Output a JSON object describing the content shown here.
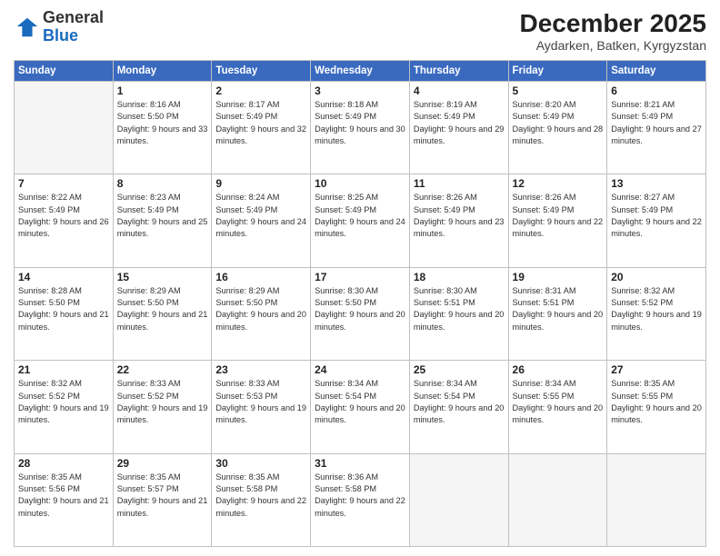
{
  "logo": {
    "general": "General",
    "blue": "Blue"
  },
  "title": {
    "month": "December 2025",
    "location": "Aydarken, Batken, Kyrgyzstan"
  },
  "headers": [
    "Sunday",
    "Monday",
    "Tuesday",
    "Wednesday",
    "Thursday",
    "Friday",
    "Saturday"
  ],
  "weeks": [
    [
      {
        "day": "",
        "empty": true
      },
      {
        "day": "1",
        "sunrise": "Sunrise: 8:16 AM",
        "sunset": "Sunset: 5:50 PM",
        "daylight": "Daylight: 9 hours and 33 minutes."
      },
      {
        "day": "2",
        "sunrise": "Sunrise: 8:17 AM",
        "sunset": "Sunset: 5:49 PM",
        "daylight": "Daylight: 9 hours and 32 minutes."
      },
      {
        "day": "3",
        "sunrise": "Sunrise: 8:18 AM",
        "sunset": "Sunset: 5:49 PM",
        "daylight": "Daylight: 9 hours and 30 minutes."
      },
      {
        "day": "4",
        "sunrise": "Sunrise: 8:19 AM",
        "sunset": "Sunset: 5:49 PM",
        "daylight": "Daylight: 9 hours and 29 minutes."
      },
      {
        "day": "5",
        "sunrise": "Sunrise: 8:20 AM",
        "sunset": "Sunset: 5:49 PM",
        "daylight": "Daylight: 9 hours and 28 minutes."
      },
      {
        "day": "6",
        "sunrise": "Sunrise: 8:21 AM",
        "sunset": "Sunset: 5:49 PM",
        "daylight": "Daylight: 9 hours and 27 minutes."
      }
    ],
    [
      {
        "day": "7",
        "sunrise": "Sunrise: 8:22 AM",
        "sunset": "Sunset: 5:49 PM",
        "daylight": "Daylight: 9 hours and 26 minutes."
      },
      {
        "day": "8",
        "sunrise": "Sunrise: 8:23 AM",
        "sunset": "Sunset: 5:49 PM",
        "daylight": "Daylight: 9 hours and 25 minutes."
      },
      {
        "day": "9",
        "sunrise": "Sunrise: 8:24 AM",
        "sunset": "Sunset: 5:49 PM",
        "daylight": "Daylight: 9 hours and 24 minutes."
      },
      {
        "day": "10",
        "sunrise": "Sunrise: 8:25 AM",
        "sunset": "Sunset: 5:49 PM",
        "daylight": "Daylight: 9 hours and 24 minutes."
      },
      {
        "day": "11",
        "sunrise": "Sunrise: 8:26 AM",
        "sunset": "Sunset: 5:49 PM",
        "daylight": "Daylight: 9 hours and 23 minutes."
      },
      {
        "day": "12",
        "sunrise": "Sunrise: 8:26 AM",
        "sunset": "Sunset: 5:49 PM",
        "daylight": "Daylight: 9 hours and 22 minutes."
      },
      {
        "day": "13",
        "sunrise": "Sunrise: 8:27 AM",
        "sunset": "Sunset: 5:49 PM",
        "daylight": "Daylight: 9 hours and 22 minutes."
      }
    ],
    [
      {
        "day": "14",
        "sunrise": "Sunrise: 8:28 AM",
        "sunset": "Sunset: 5:50 PM",
        "daylight": "Daylight: 9 hours and 21 minutes."
      },
      {
        "day": "15",
        "sunrise": "Sunrise: 8:29 AM",
        "sunset": "Sunset: 5:50 PM",
        "daylight": "Daylight: 9 hours and 21 minutes."
      },
      {
        "day": "16",
        "sunrise": "Sunrise: 8:29 AM",
        "sunset": "Sunset: 5:50 PM",
        "daylight": "Daylight: 9 hours and 20 minutes."
      },
      {
        "day": "17",
        "sunrise": "Sunrise: 8:30 AM",
        "sunset": "Sunset: 5:50 PM",
        "daylight": "Daylight: 9 hours and 20 minutes."
      },
      {
        "day": "18",
        "sunrise": "Sunrise: 8:30 AM",
        "sunset": "Sunset: 5:51 PM",
        "daylight": "Daylight: 9 hours and 20 minutes."
      },
      {
        "day": "19",
        "sunrise": "Sunrise: 8:31 AM",
        "sunset": "Sunset: 5:51 PM",
        "daylight": "Daylight: 9 hours and 20 minutes."
      },
      {
        "day": "20",
        "sunrise": "Sunrise: 8:32 AM",
        "sunset": "Sunset: 5:52 PM",
        "daylight": "Daylight: 9 hours and 19 minutes."
      }
    ],
    [
      {
        "day": "21",
        "sunrise": "Sunrise: 8:32 AM",
        "sunset": "Sunset: 5:52 PM",
        "daylight": "Daylight: 9 hours and 19 minutes."
      },
      {
        "day": "22",
        "sunrise": "Sunrise: 8:33 AM",
        "sunset": "Sunset: 5:52 PM",
        "daylight": "Daylight: 9 hours and 19 minutes."
      },
      {
        "day": "23",
        "sunrise": "Sunrise: 8:33 AM",
        "sunset": "Sunset: 5:53 PM",
        "daylight": "Daylight: 9 hours and 19 minutes."
      },
      {
        "day": "24",
        "sunrise": "Sunrise: 8:34 AM",
        "sunset": "Sunset: 5:54 PM",
        "daylight": "Daylight: 9 hours and 20 minutes."
      },
      {
        "day": "25",
        "sunrise": "Sunrise: 8:34 AM",
        "sunset": "Sunset: 5:54 PM",
        "daylight": "Daylight: 9 hours and 20 minutes."
      },
      {
        "day": "26",
        "sunrise": "Sunrise: 8:34 AM",
        "sunset": "Sunset: 5:55 PM",
        "daylight": "Daylight: 9 hours and 20 minutes."
      },
      {
        "day": "27",
        "sunrise": "Sunrise: 8:35 AM",
        "sunset": "Sunset: 5:55 PM",
        "daylight": "Daylight: 9 hours and 20 minutes."
      }
    ],
    [
      {
        "day": "28",
        "sunrise": "Sunrise: 8:35 AM",
        "sunset": "Sunset: 5:56 PM",
        "daylight": "Daylight: 9 hours and 21 minutes."
      },
      {
        "day": "29",
        "sunrise": "Sunrise: 8:35 AM",
        "sunset": "Sunset: 5:57 PM",
        "daylight": "Daylight: 9 hours and 21 minutes."
      },
      {
        "day": "30",
        "sunrise": "Sunrise: 8:35 AM",
        "sunset": "Sunset: 5:58 PM",
        "daylight": "Daylight: 9 hours and 22 minutes."
      },
      {
        "day": "31",
        "sunrise": "Sunrise: 8:36 AM",
        "sunset": "Sunset: 5:58 PM",
        "daylight": "Daylight: 9 hours and 22 minutes."
      },
      {
        "day": "",
        "empty": true
      },
      {
        "day": "",
        "empty": true
      },
      {
        "day": "",
        "empty": true
      }
    ]
  ]
}
